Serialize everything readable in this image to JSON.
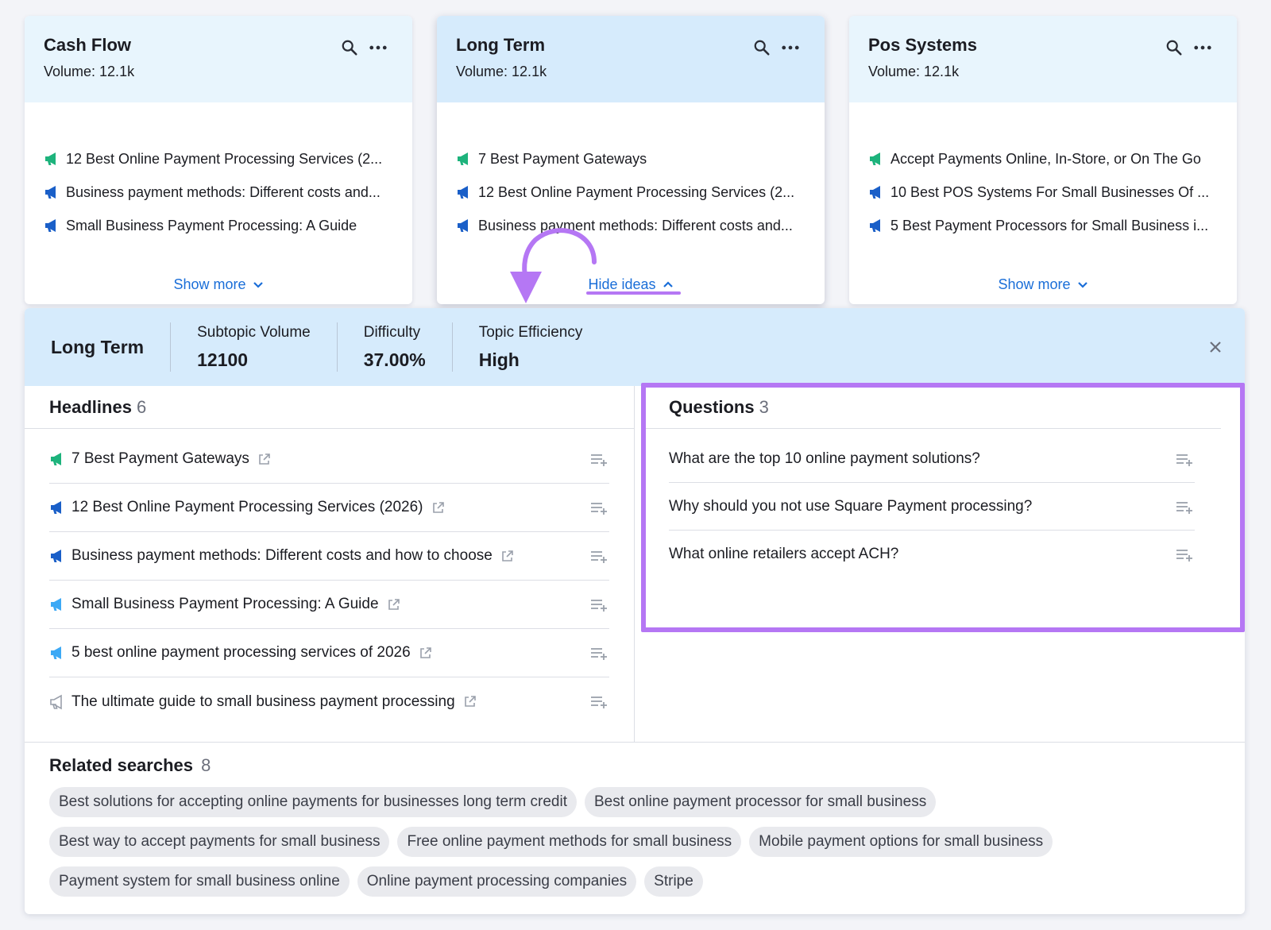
{
  "colors": {
    "card_head": "#e8f5fd",
    "card_head_active": "#d6ebfc",
    "link": "#1a6ed8",
    "highlight": "#b577f4",
    "green_mega": "#1db37c",
    "blue_mega": "#1a5fc8",
    "lightblue_mega": "#3da9f5",
    "gray_mega": "#9aa0ab"
  },
  "cards": [
    {
      "title": "Cash Flow",
      "volume": "Volume: 12.1k",
      "items": [
        {
          "text": "12 Best Online Payment Processing Services (2...",
          "icon": "megaphone-green-icon"
        },
        {
          "text": "Business payment methods: Different costs and...",
          "icon": "megaphone-blue-icon"
        },
        {
          "text": "Small Business Payment Processing: A Guide",
          "icon": "megaphone-blue-icon"
        }
      ],
      "footer_label": "Show more"
    },
    {
      "title": "Long Term",
      "volume": "Volume: 12.1k",
      "items": [
        {
          "text": "7 Best Payment Gateways",
          "icon": "megaphone-green-icon"
        },
        {
          "text": "12 Best Online Payment Processing Services (2...",
          "icon": "megaphone-blue-icon"
        },
        {
          "text": "Business payment methods: Different costs and...",
          "icon": "megaphone-blue-icon"
        }
      ],
      "footer_label": "Hide ideas"
    },
    {
      "title": "Pos Systems",
      "volume": "Volume: 12.1k",
      "items": [
        {
          "text": "Accept Payments Online, In-Store, or On The Go",
          "icon": "megaphone-green-icon"
        },
        {
          "text": "10 Best POS Systems For Small Businesses Of ...",
          "icon": "megaphone-blue-icon"
        },
        {
          "text": "5 Best Payment Processors for Small Business i...",
          "icon": "megaphone-blue-icon"
        }
      ],
      "footer_label": "Show more"
    }
  ],
  "panel": {
    "title": "Long Term",
    "metrics": [
      {
        "label": "Subtopic Volume",
        "value": "12100"
      },
      {
        "label": "Difficulty",
        "value": "37.00%"
      },
      {
        "label": "Topic Efficiency",
        "value": "High"
      }
    ],
    "headlines": {
      "title": "Headlines",
      "count": "6",
      "items": [
        {
          "text": "7 Best Payment Gateways",
          "icon": "megaphone-green-icon"
        },
        {
          "text": "12 Best Online Payment Processing Services (2026)",
          "icon": "megaphone-blue-icon"
        },
        {
          "text": "Business payment methods: Different costs and how to choose",
          "icon": "megaphone-blue-icon"
        },
        {
          "text": "Small Business Payment Processing: A Guide",
          "icon": "megaphone-lightblue-icon"
        },
        {
          "text": "5 best online payment processing services of 2026",
          "icon": "megaphone-lightblue-icon"
        },
        {
          "text": "The ultimate guide to small business payment processing",
          "icon": "megaphone-gray-icon"
        }
      ]
    },
    "questions": {
      "title": "Questions",
      "count": "3",
      "items": [
        "What are the top 10 online payment solutions?",
        "Why should you not use Square Payment processing?",
        "What online retailers accept ACH?"
      ]
    },
    "related": {
      "title": "Related searches",
      "count": "8",
      "items": [
        "Best solutions for accepting online payments for businesses long term credit",
        "Best online payment processor for small business",
        "Best way to accept payments for small business",
        "Free online payment methods for small business",
        "Mobile payment options for small business",
        "Payment system for small business online",
        "Online payment processing companies",
        "Stripe"
      ]
    }
  }
}
